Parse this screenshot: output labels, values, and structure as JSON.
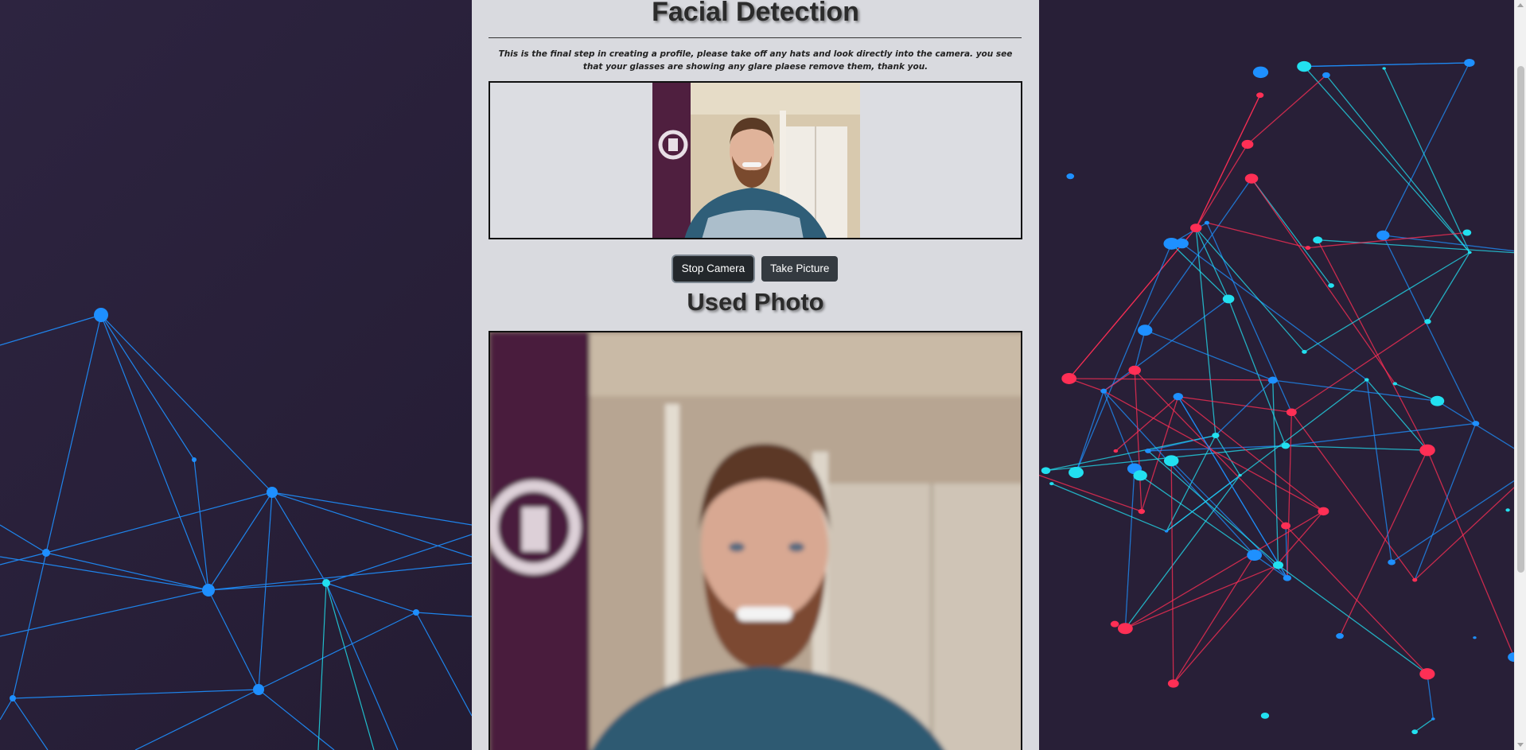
{
  "page": {
    "title": "Facial Detection",
    "instructions": "This is the final step in creating a profile, please take off any hats and look directly into the camera. you see that your glasses are showing any glare plaese remove them, thank you.",
    "used_photo_title": "Used Photo"
  },
  "buttons": {
    "stop_camera": "Stop Camera",
    "take_picture": "Take Picture"
  },
  "colors": {
    "panel_bg": "#d9dadf",
    "page_bg": "#2a2038",
    "button_bg": "#343a40",
    "network_blue": "#1e90ff",
    "network_cyan": "#22e0f0",
    "network_red": "#ff2f55"
  },
  "icons": {
    "left_background": "network-graph-icon",
    "right_background": "network-globe-icon"
  }
}
